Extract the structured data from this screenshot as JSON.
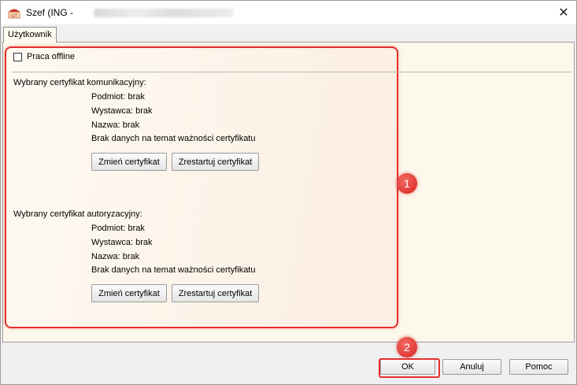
{
  "window": {
    "title": "Szef (ING -",
    "app_icon_label": "GT"
  },
  "tabs": [
    {
      "label": "Użytkownik"
    }
  ],
  "offline": {
    "label": "Praca offline",
    "checked": false
  },
  "comm_cert": {
    "heading": "Wybrany certyfikat komunikacyjny:",
    "subject": "Podmiot: brak",
    "issuer": "Wystawca: brak",
    "name": "Nazwa: brak",
    "validity": "Brak danych na temat ważności certyfikatu",
    "change_label": "Zmień certyfikat",
    "restart_label": "Zrestartuj certyfikat"
  },
  "auth_cert": {
    "heading": "Wybrany certyfikat autoryzacyjny:",
    "subject": "Podmiot: brak",
    "issuer": "Wystawca: brak",
    "name": "Nazwa: brak",
    "validity": "Brak danych na temat ważności certyfikatu",
    "change_label": "Zmień certyfikat",
    "restart_label": "Zrestartuj certyfikat"
  },
  "footer": {
    "ok_label": "OK",
    "cancel_label": "Anuluj",
    "help_label": "Pomoc"
  },
  "annotations": {
    "badge_1": "1",
    "badge_2": "2",
    "color": "#e5302e"
  }
}
